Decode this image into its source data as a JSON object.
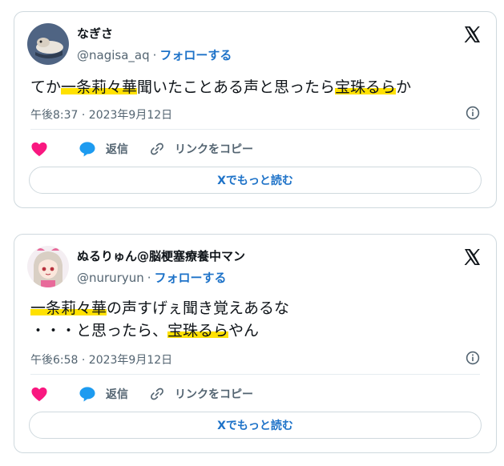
{
  "tweets": [
    {
      "display_name": "なぎさ",
      "handle": "@nagisa_aq",
      "separator": "·",
      "follow_label": "フォローする",
      "text_parts": [
        "てか",
        "一条莉々華",
        "聞いたことある声と思ったら",
        "宝珠るら",
        "か"
      ],
      "timestamp": "午後8:37 · 2023年9月12日",
      "like_icon": "heart-icon",
      "reply_label": "返信",
      "copy_link_label": "リンクをコピー",
      "read_more_label": "Xでもっと読む"
    },
    {
      "display_name": "ぬるりゅん@脳梗塞療養中マン",
      "handle": "@nururyun",
      "separator": "·",
      "follow_label": "フォローする",
      "line1_parts": [
        "一条莉々華",
        "の声すげぇ聞き覚えあるな"
      ],
      "line2_parts": [
        "・・・と思ったら、",
        "宝珠るら",
        "やん"
      ],
      "timestamp": "午後6:58 · 2023年9月12日",
      "like_icon": "heart-icon",
      "reply_label": "返信",
      "copy_link_label": "リンクをコピー",
      "read_more_label": "Xでもっと読む"
    }
  ],
  "colors": {
    "link_blue": "#1d72c8",
    "highlight_yellow": "#ffe100",
    "heart_pink": "#f91880",
    "reply_blue": "#1d9bf0",
    "muted_gray": "#536471"
  }
}
